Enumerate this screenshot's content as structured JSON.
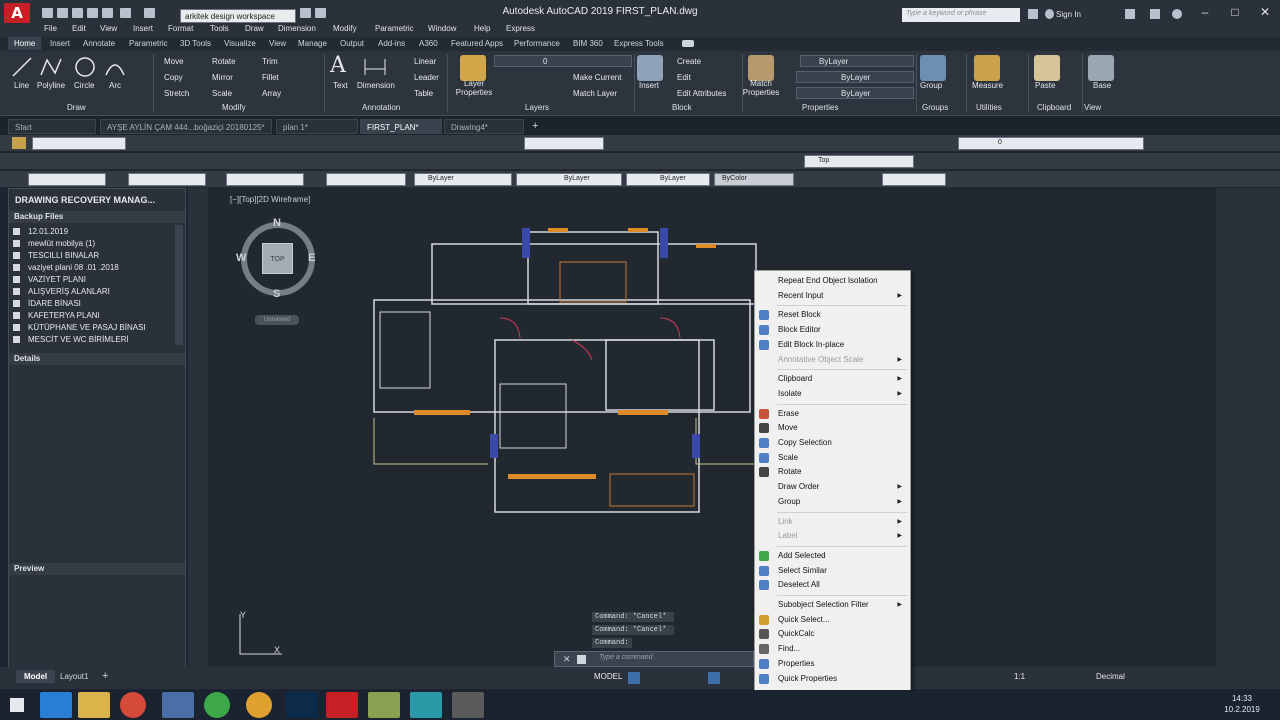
{
  "window": {
    "title": "Autodesk AutoCAD 2019    FIRST_PLAN.dwg",
    "workspace": "arkitek design workspace",
    "search_placeholder": "Type a keyword or phrase",
    "sign_in": "Sign In"
  },
  "menubar": [
    "File",
    "Edit",
    "View",
    "Insert",
    "Format",
    "Tools",
    "Draw",
    "Dimension",
    "Modify",
    "Parametric",
    "Window",
    "Help",
    "Express"
  ],
  "ribbon_tabs": [
    "Home",
    "Insert",
    "Annotate",
    "Parametric",
    "3D Tools",
    "Visualize",
    "View",
    "Manage",
    "Output",
    "Add-ins",
    "A360",
    "Featured Apps",
    "Performance",
    "BIM 360",
    "Express Tools"
  ],
  "ribbon": {
    "draw": {
      "title": "Draw",
      "line": "Line",
      "polyline": "Polyline",
      "circle": "Circle",
      "arc": "Arc"
    },
    "modify": {
      "title": "Modify",
      "move": "Move",
      "copy": "Copy",
      "stretch": "Stretch",
      "rotate": "Rotate",
      "mirror": "Mirror",
      "scale": "Scale",
      "trim": "Trim",
      "fillet": "Fillet",
      "array": "Array"
    },
    "annotation": {
      "title": "Annotation",
      "text": "Text",
      "dimension": "Dimension",
      "linear": "Linear",
      "leader": "Leader",
      "table": "Table"
    },
    "layers": {
      "title": "Layers",
      "layer_properties": "Layer Properties",
      "current_layer": "0",
      "make_current": "Make Current",
      "match_layer": "Match Layer"
    },
    "block": {
      "title": "Block",
      "insert": "Insert",
      "create": "Create",
      "edit": "Edit",
      "edit_attributes": "Edit Attributes"
    },
    "properties": {
      "title": "Properties",
      "match": "Match Properties",
      "bylayer1": "ByLayer",
      "bylayer2": "ByLayer",
      "bylayer3": "ByLayer"
    },
    "groups": {
      "title": "Groups",
      "group": "Group"
    },
    "utilities": {
      "title": "Utilities",
      "measure": "Measure"
    },
    "clipboard": {
      "title": "Clipboard",
      "paste": "Paste"
    },
    "view": {
      "title": "View",
      "base": "Base"
    }
  },
  "file_tabs": [
    "Start",
    "AYŞE AYLİN ÇAM 444...boğaziçi 20180125*",
    "plan 1*",
    "FIRST_PLAN*",
    "Drawing4*"
  ],
  "toolbar": {
    "layer_value": "0",
    "view_value": "Top",
    "bylayer_a": "ByLayer",
    "bylayer_b": "ByLayer",
    "bylayer_c": "ByLayer",
    "bycolor": "ByColor"
  },
  "recovery": {
    "title": "DRAWING RECOVERY MANAG...",
    "backup_header": "Backup Files",
    "files": [
      "12.01.2019",
      "mewlüt mobilya (1)",
      "TESCILLI BINALAR",
      "vaziyet plani 08 .01 .2018",
      "VAZİYET PLANI",
      "ALIŞVERİŞ ALANLARI",
      "İDARE BİNASI",
      "KAFETERYA PLANI",
      "KÜTÜPHANE VE PASAJ BİNASI",
      "MESCİT VE WC BİRİMLERİ"
    ],
    "details": "Details",
    "preview": "Preview"
  },
  "viewport": {
    "label": "[−][Top][2D Wireframe]",
    "cube_top": "TOP",
    "north": "N",
    "south": "S",
    "east": "E",
    "west": "W",
    "ucs_name": "Unnamed",
    "y_axis": "Y",
    "x_axis": "X"
  },
  "command": {
    "history": [
      "Command: *Cancel*",
      "Command: *Cancel*",
      "Command:"
    ],
    "placeholder": "Type a command"
  },
  "layout_tabs": [
    "Model",
    "Layout1"
  ],
  "status": {
    "model": "MODEL",
    "units": "Decimal",
    "scale": "1:1"
  },
  "context_menu": {
    "items": [
      {
        "label": "Repeat End Object Isolation",
        "arrow": false,
        "disabled": false
      },
      {
        "label": "Recent Input",
        "arrow": true,
        "disabled": false
      },
      {
        "label": "Reset Block",
        "arrow": false,
        "disabled": false
      },
      {
        "label": "Block Editor",
        "arrow": false,
        "disabled": false
      },
      {
        "label": "Edit Block In-place",
        "arrow": false,
        "disabled": false
      },
      {
        "label": "Annotative Object Scale",
        "arrow": true,
        "disabled": true
      },
      {
        "label": "Clipboard",
        "arrow": true,
        "disabled": false
      },
      {
        "label": "Isolate",
        "arrow": true,
        "disabled": false
      },
      {
        "label": "Erase",
        "arrow": false,
        "disabled": false
      },
      {
        "label": "Move",
        "arrow": false,
        "disabled": false
      },
      {
        "label": "Copy Selection",
        "arrow": false,
        "disabled": false
      },
      {
        "label": "Scale",
        "arrow": false,
        "disabled": false
      },
      {
        "label": "Rotate",
        "arrow": false,
        "disabled": false
      },
      {
        "label": "Draw Order",
        "arrow": true,
        "disabled": false
      },
      {
        "label": "Group",
        "arrow": true,
        "disabled": false
      },
      {
        "label": "Link",
        "arrow": true,
        "disabled": true
      },
      {
        "label": "Label",
        "arrow": true,
        "disabled": true
      },
      {
        "label": "Add Selected",
        "arrow": false,
        "disabled": false
      },
      {
        "label": "Select Similar",
        "arrow": false,
        "disabled": false
      },
      {
        "label": "Deselect All",
        "arrow": false,
        "disabled": false
      },
      {
        "label": "Subobject Selection Filter",
        "arrow": true,
        "disabled": false
      },
      {
        "label": "Quick Select...",
        "arrow": false,
        "disabled": false
      },
      {
        "label": "QuickCalc",
        "arrow": false,
        "disabled": false
      },
      {
        "label": "Find...",
        "arrow": false,
        "disabled": false
      },
      {
        "label": "Properties",
        "arrow": false,
        "disabled": false
      },
      {
        "label": "Quick Properties",
        "arrow": false,
        "disabled": false
      }
    ]
  },
  "taskbar": {
    "time": "14:33",
    "date": "10.2.2019"
  }
}
